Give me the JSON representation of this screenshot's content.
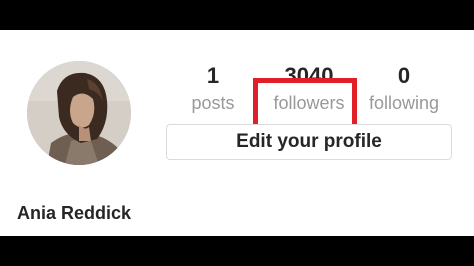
{
  "profile": {
    "username": "Ania Reddick",
    "edit_button_label": "Edit your profile"
  },
  "stats": {
    "posts": {
      "count": "1",
      "label": "posts"
    },
    "followers": {
      "count": "3040",
      "label": "followers"
    },
    "following": {
      "count": "0",
      "label": "following"
    }
  },
  "colors": {
    "highlight": "#e02026",
    "count_text": "#262626",
    "label_text": "#999999",
    "button_border": "#dbdbdb",
    "frame": "#000000"
  }
}
